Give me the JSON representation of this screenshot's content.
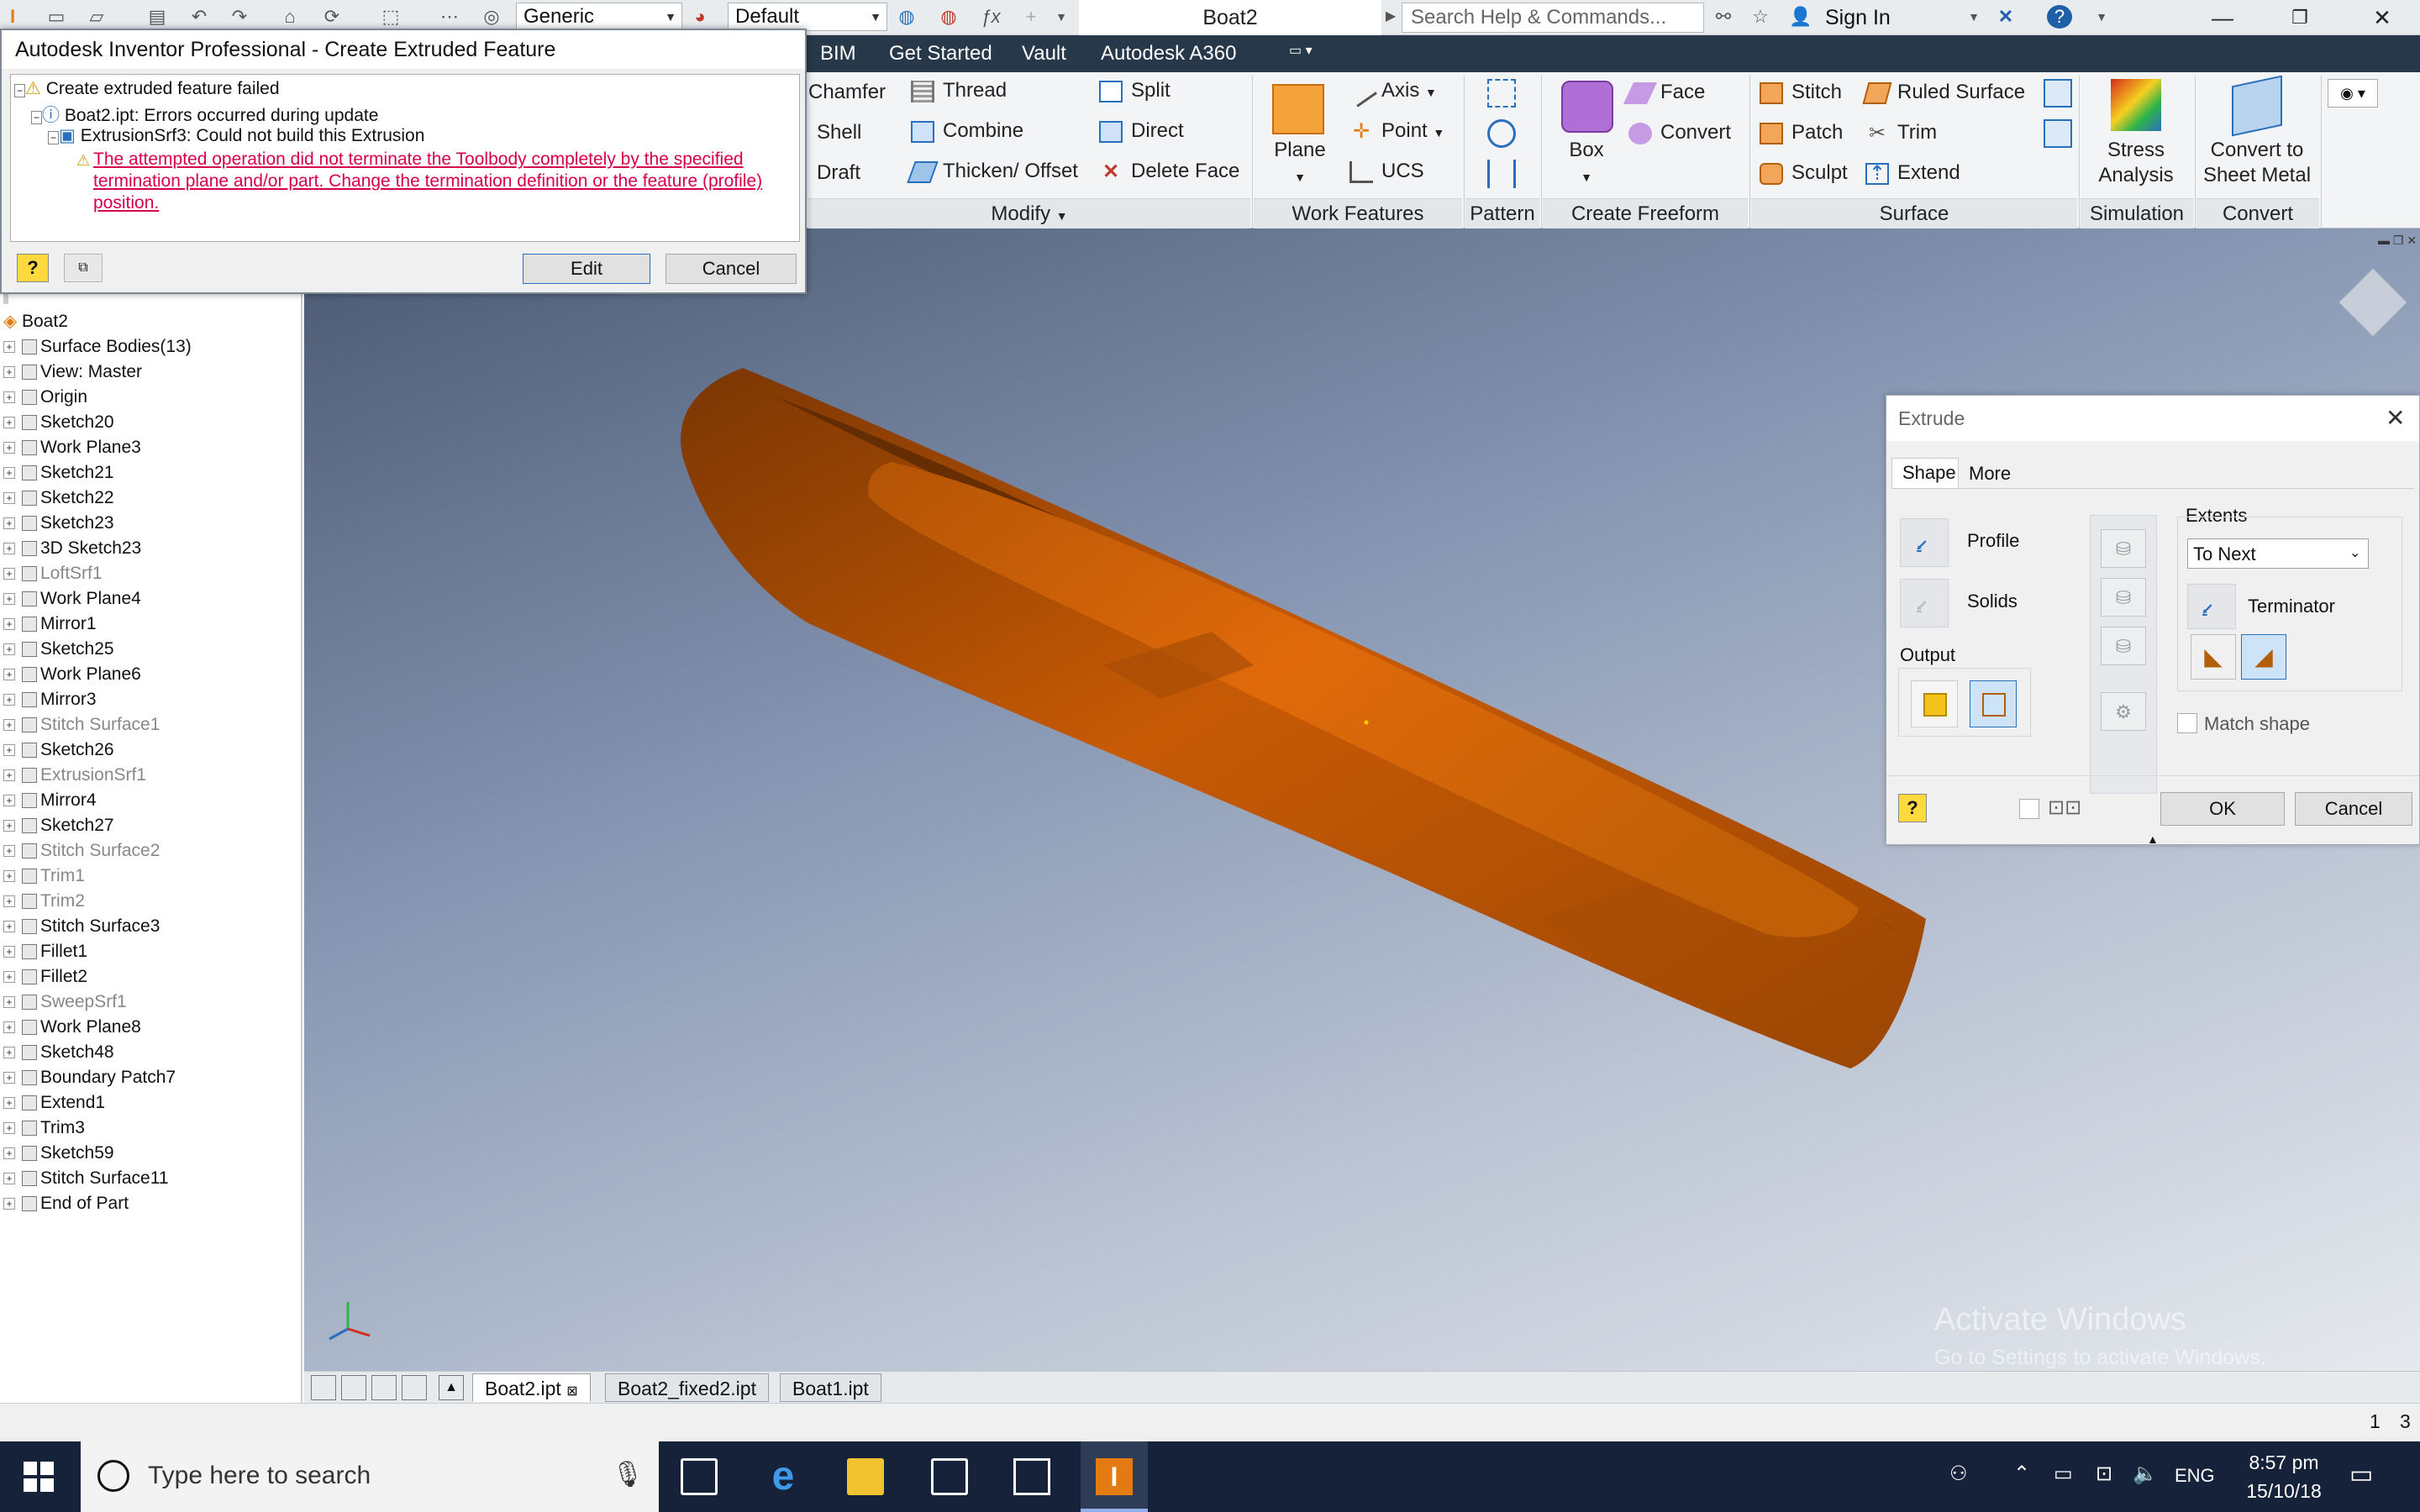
{
  "app": {
    "document_title": "Boat2",
    "search_placeholder": "Search Help & Commands...",
    "sign_in": "Sign In",
    "material_combo": "Generic",
    "appearance_combo": "Default"
  },
  "ribbon_tabs": [
    "BIM",
    "Get Started",
    "Vault",
    "Autodesk A360"
  ],
  "ribbon": {
    "modify": {
      "label": "Modify",
      "items": [
        "Chamfer",
        "Shell",
        "Draft",
        "Thread",
        "Combine",
        "Thicken/ Offset",
        "Split",
        "Direct",
        "Delete Face"
      ]
    },
    "work_features": {
      "label": "Work Features",
      "plane": "Plane",
      "items": [
        "Axis",
        "Point",
        "UCS"
      ]
    },
    "pattern": {
      "label": "Pattern"
    },
    "create_freeform": {
      "label": "Create Freeform",
      "box": "Box",
      "items": [
        "Face",
        "Convert"
      ]
    },
    "surface": {
      "label": "Surface",
      "items": [
        "Stitch",
        "Patch",
        "Sculpt",
        "Ruled Surface",
        "Trim",
        "Extend"
      ]
    },
    "simulation": {
      "label": "Simulation",
      "stress_line1": "Stress",
      "stress_line2": "Analysis"
    },
    "convert": {
      "label": "Convert",
      "line1": "Convert to",
      "line2": "Sheet Metal"
    }
  },
  "error_dialog": {
    "title": "Autodesk Inventor Professional - Create Extruded Feature",
    "line1": "Create extruded feature failed",
    "line2": "Boat2.ipt: Errors occurred during update",
    "line3": "ExtrusionSrf3: Could not build this Extrusion",
    "detail1": "The attempted operation did not terminate the Toolbody completely by the specified",
    "detail2": "termination plane and/or part. Change the termination definition or the feature (profile)",
    "detail3": "position.",
    "edit": "Edit",
    "cancel": "Cancel"
  },
  "browser": {
    "root": "Boat2",
    "items": [
      {
        "label": "Surface Bodies(13)",
        "dim": false
      },
      {
        "label": "View: Master",
        "dim": false
      },
      {
        "label": "Origin",
        "dim": false
      },
      {
        "label": "Sketch20",
        "dim": false
      },
      {
        "label": "Work Plane3",
        "dim": false
      },
      {
        "label": "Sketch21",
        "dim": false
      },
      {
        "label": "Sketch22",
        "dim": false
      },
      {
        "label": "Sketch23",
        "dim": false
      },
      {
        "label": "3D Sketch23",
        "dim": false
      },
      {
        "label": "LoftSrf1",
        "dim": true
      },
      {
        "label": "Work Plane4",
        "dim": false
      },
      {
        "label": "Mirror1",
        "dim": false
      },
      {
        "label": "Sketch25",
        "dim": false
      },
      {
        "label": "Work Plane6",
        "dim": false
      },
      {
        "label": "Mirror3",
        "dim": false
      },
      {
        "label": "Stitch Surface1",
        "dim": true
      },
      {
        "label": "Sketch26",
        "dim": false
      },
      {
        "label": "ExtrusionSrf1",
        "dim": true
      },
      {
        "label": "Mirror4",
        "dim": false
      },
      {
        "label": "Sketch27",
        "dim": false
      },
      {
        "label": "Stitch Surface2",
        "dim": true
      },
      {
        "label": "Trim1",
        "dim": true
      },
      {
        "label": "Trim2",
        "dim": true
      },
      {
        "label": "Stitch Surface3",
        "dim": false
      },
      {
        "label": "Fillet1",
        "dim": false
      },
      {
        "label": "Fillet2",
        "dim": false
      },
      {
        "label": "SweepSrf1",
        "dim": true
      },
      {
        "label": "Work Plane8",
        "dim": false
      },
      {
        "label": "Sketch48",
        "dim": false
      },
      {
        "label": "Boundary Patch7",
        "dim": false
      },
      {
        "label": "Extend1",
        "dim": false
      },
      {
        "label": "Trim3",
        "dim": false
      },
      {
        "label": "Sketch59",
        "dim": false
      },
      {
        "label": "Stitch Surface11",
        "dim": false
      },
      {
        "label": "End of Part",
        "dim": false
      }
    ]
  },
  "extrude_dialog": {
    "title": "Extrude",
    "tab_shape": "Shape",
    "tab_more": "More",
    "profile": "Profile",
    "solids": "Solids",
    "output": "Output",
    "extents": "Extents",
    "extents_value": "To Next",
    "terminator": "Terminator",
    "match_shape": "Match shape",
    "ok": "OK",
    "cancel": "Cancel"
  },
  "file_tabs": [
    "Boat2.ipt",
    "Boat2_fixed2.ipt",
    "Boat1.ipt"
  ],
  "status": {
    "right1": "1",
    "right2": "3"
  },
  "watermark": {
    "line1": "Activate Windows",
    "line2": "Go to Settings to activate Windows."
  },
  "taskbar": {
    "search_placeholder": "Type here to search",
    "lang": "ENG",
    "time": "8:57 pm",
    "date": "15/10/18"
  },
  "colors": {
    "model": "#c75a05",
    "ribbon_tab_bg": "#263849",
    "error_text": "#d6004c"
  }
}
